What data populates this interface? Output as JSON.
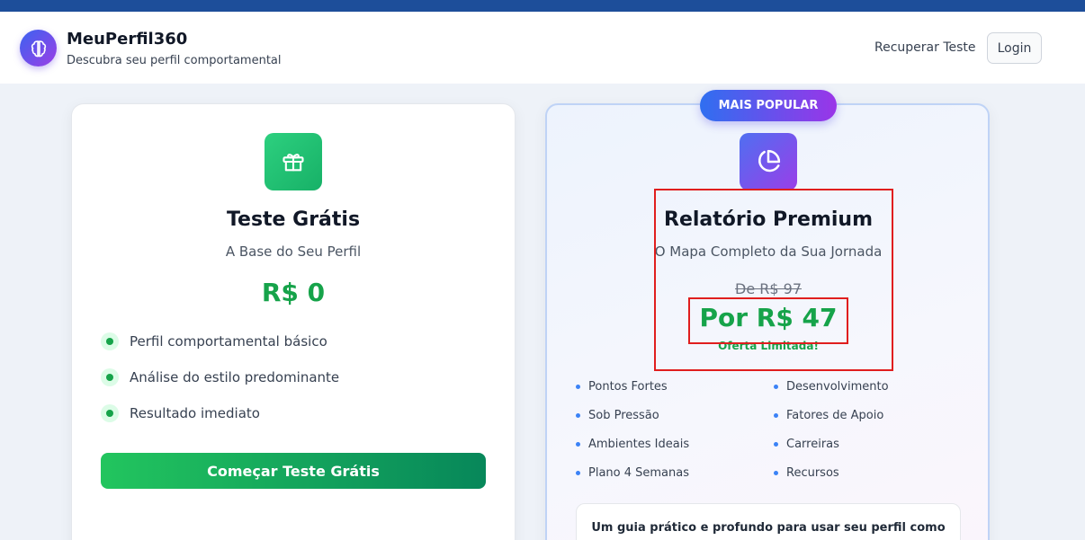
{
  "header": {
    "brand_title": "MeuPerfil360",
    "brand_subtitle": "Descubra seu perfil comportamental",
    "nav_recover": "Recuperar Teste",
    "login_label": "Login"
  },
  "free_plan": {
    "title": "Teste Grátis",
    "subtitle": "A Base do Seu Perfil",
    "price": "R$ 0",
    "features": [
      "Perfil comportamental básico",
      "Análise do estilo predominante",
      "Resultado imediato"
    ],
    "cta_label": "Começar Teste Grátis"
  },
  "premium_plan": {
    "badge": "MAIS POPULAR",
    "title": "Relatório Premium",
    "subtitle": "O Mapa Completo da Sua Jornada",
    "old_price": "De R$ 97",
    "new_price": "Por R$ 47",
    "offer_note": "Oferta Limitada!",
    "items_left": [
      "Pontos Fortes",
      "Sob Pressão",
      "Ambientes Ideais",
      "Plano 4 Semanas"
    ],
    "items_right": [
      "Desenvolvimento",
      "Fatores de Apoio",
      "Carreiras",
      "Recursos"
    ],
    "guide_text": "Um guia prático e profundo para usar seu perfil como"
  },
  "colors": {
    "accent_green": "#16a34a",
    "brand_gradient_start": "#3b63f0",
    "brand_gradient_end": "#9b3ee6",
    "highlight_red": "#e01e1e"
  },
  "icons": {
    "logo": "brain-icon",
    "free": "gift-icon",
    "premium": "pie-chart-icon"
  }
}
